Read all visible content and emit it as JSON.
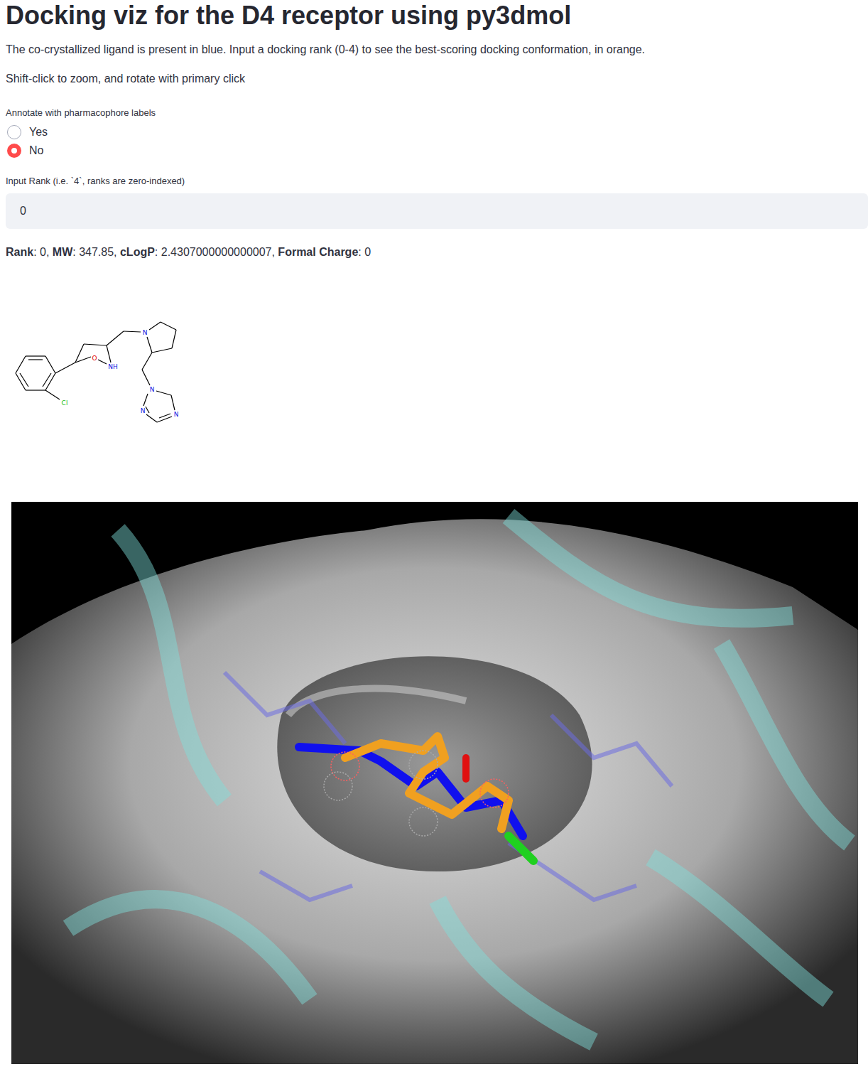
{
  "title": "Docking viz for the D4 receptor using py3dmol",
  "description": [
    "The co-crystallized ligand is present in blue. Input a docking rank (0-4) to see the best-scoring docking conformation, in orange.",
    "Shift-click to zoom, and rotate with primary click"
  ],
  "radio": {
    "label": "Annotate with pharmacophore labels",
    "options": [
      {
        "label": "Yes",
        "selected": false
      },
      {
        "label": "No",
        "selected": true
      }
    ]
  },
  "rank_input": {
    "label": "Input Rank (i.e. `4`, ranks are zero-indexed)",
    "value": "0"
  },
  "properties": {
    "delimiter": ": ",
    "separator": ", ",
    "items": [
      {
        "name": "Rank",
        "value": "0"
      },
      {
        "name": "MW",
        "value": "347.85"
      },
      {
        "name": "cLogP",
        "value": "2.4307000000000007"
      },
      {
        "name": "Formal Charge",
        "value": "0"
      }
    ]
  },
  "molecule": {
    "atoms": [
      {
        "label": "O",
        "color": "#e00000"
      },
      {
        "label": "NH",
        "color": "#1010e0"
      },
      {
        "label": "N",
        "color": "#1010e0"
      },
      {
        "label": "N",
        "color": "#1010e0"
      },
      {
        "label": "N",
        "color": "#1010e0"
      },
      {
        "label": "N",
        "color": "#1010e0"
      },
      {
        "label": "Cl",
        "color": "#20c020"
      }
    ]
  }
}
